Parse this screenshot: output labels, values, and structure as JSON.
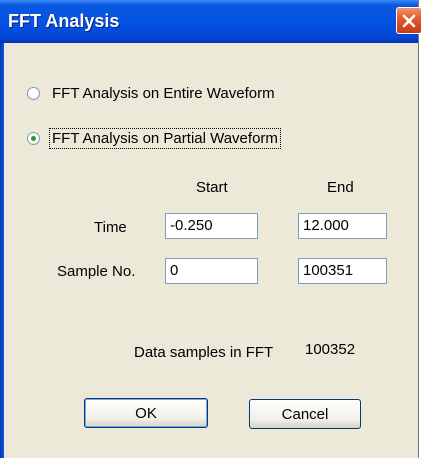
{
  "window": {
    "title": "FFT Analysis",
    "close_icon": "close-icon",
    "colors": {
      "titlebar": "#0454e4",
      "close": "#e0562b",
      "body": "#ece9d8"
    }
  },
  "options": [
    {
      "label": "FFT Analysis on Entire Waveform",
      "selected": false
    },
    {
      "label": "FFT Analysis on Partial Waveform",
      "selected": true
    }
  ],
  "columns": {
    "start": "Start",
    "end": "End"
  },
  "rows": {
    "time": {
      "label": "Time",
      "start": "-0.250",
      "end": "12.000"
    },
    "sample": {
      "label": "Sample No.",
      "start": "0",
      "end": "100351"
    }
  },
  "info": {
    "label": "Data samples in FFT",
    "value": "100352"
  },
  "buttons": {
    "ok": "OK",
    "cancel": "Cancel"
  }
}
